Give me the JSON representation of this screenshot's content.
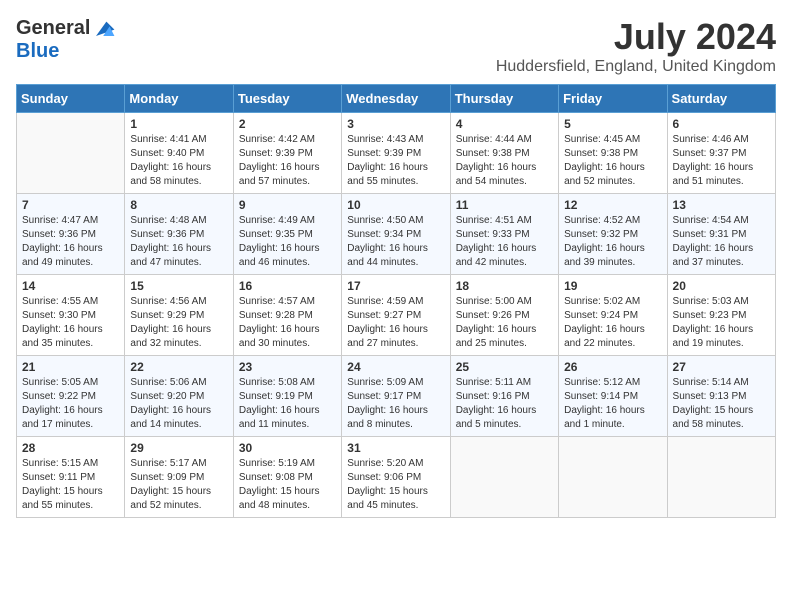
{
  "header": {
    "logo_general": "General",
    "logo_blue": "Blue",
    "month_year": "July 2024",
    "location": "Huddersfield, England, United Kingdom"
  },
  "days_of_week": [
    "Sunday",
    "Monday",
    "Tuesday",
    "Wednesday",
    "Thursday",
    "Friday",
    "Saturday"
  ],
  "weeks": [
    [
      {
        "day": "",
        "sunrise": "",
        "sunset": "",
        "daylight": ""
      },
      {
        "day": "1",
        "sunrise": "Sunrise: 4:41 AM",
        "sunset": "Sunset: 9:40 PM",
        "daylight": "Daylight: 16 hours and 58 minutes."
      },
      {
        "day": "2",
        "sunrise": "Sunrise: 4:42 AM",
        "sunset": "Sunset: 9:39 PM",
        "daylight": "Daylight: 16 hours and 57 minutes."
      },
      {
        "day": "3",
        "sunrise": "Sunrise: 4:43 AM",
        "sunset": "Sunset: 9:39 PM",
        "daylight": "Daylight: 16 hours and 55 minutes."
      },
      {
        "day": "4",
        "sunrise": "Sunrise: 4:44 AM",
        "sunset": "Sunset: 9:38 PM",
        "daylight": "Daylight: 16 hours and 54 minutes."
      },
      {
        "day": "5",
        "sunrise": "Sunrise: 4:45 AM",
        "sunset": "Sunset: 9:38 PM",
        "daylight": "Daylight: 16 hours and 52 minutes."
      },
      {
        "day": "6",
        "sunrise": "Sunrise: 4:46 AM",
        "sunset": "Sunset: 9:37 PM",
        "daylight": "Daylight: 16 hours and 51 minutes."
      }
    ],
    [
      {
        "day": "7",
        "sunrise": "Sunrise: 4:47 AM",
        "sunset": "Sunset: 9:36 PM",
        "daylight": "Daylight: 16 hours and 49 minutes."
      },
      {
        "day": "8",
        "sunrise": "Sunrise: 4:48 AM",
        "sunset": "Sunset: 9:36 PM",
        "daylight": "Daylight: 16 hours and 47 minutes."
      },
      {
        "day": "9",
        "sunrise": "Sunrise: 4:49 AM",
        "sunset": "Sunset: 9:35 PM",
        "daylight": "Daylight: 16 hours and 46 minutes."
      },
      {
        "day": "10",
        "sunrise": "Sunrise: 4:50 AM",
        "sunset": "Sunset: 9:34 PM",
        "daylight": "Daylight: 16 hours and 44 minutes."
      },
      {
        "day": "11",
        "sunrise": "Sunrise: 4:51 AM",
        "sunset": "Sunset: 9:33 PM",
        "daylight": "Daylight: 16 hours and 42 minutes."
      },
      {
        "day": "12",
        "sunrise": "Sunrise: 4:52 AM",
        "sunset": "Sunset: 9:32 PM",
        "daylight": "Daylight: 16 hours and 39 minutes."
      },
      {
        "day": "13",
        "sunrise": "Sunrise: 4:54 AM",
        "sunset": "Sunset: 9:31 PM",
        "daylight": "Daylight: 16 hours and 37 minutes."
      }
    ],
    [
      {
        "day": "14",
        "sunrise": "Sunrise: 4:55 AM",
        "sunset": "Sunset: 9:30 PM",
        "daylight": "Daylight: 16 hours and 35 minutes."
      },
      {
        "day": "15",
        "sunrise": "Sunrise: 4:56 AM",
        "sunset": "Sunset: 9:29 PM",
        "daylight": "Daylight: 16 hours and 32 minutes."
      },
      {
        "day": "16",
        "sunrise": "Sunrise: 4:57 AM",
        "sunset": "Sunset: 9:28 PM",
        "daylight": "Daylight: 16 hours and 30 minutes."
      },
      {
        "day": "17",
        "sunrise": "Sunrise: 4:59 AM",
        "sunset": "Sunset: 9:27 PM",
        "daylight": "Daylight: 16 hours and 27 minutes."
      },
      {
        "day": "18",
        "sunrise": "Sunrise: 5:00 AM",
        "sunset": "Sunset: 9:26 PM",
        "daylight": "Daylight: 16 hours and 25 minutes."
      },
      {
        "day": "19",
        "sunrise": "Sunrise: 5:02 AM",
        "sunset": "Sunset: 9:24 PM",
        "daylight": "Daylight: 16 hours and 22 minutes."
      },
      {
        "day": "20",
        "sunrise": "Sunrise: 5:03 AM",
        "sunset": "Sunset: 9:23 PM",
        "daylight": "Daylight: 16 hours and 19 minutes."
      }
    ],
    [
      {
        "day": "21",
        "sunrise": "Sunrise: 5:05 AM",
        "sunset": "Sunset: 9:22 PM",
        "daylight": "Daylight: 16 hours and 17 minutes."
      },
      {
        "day": "22",
        "sunrise": "Sunrise: 5:06 AM",
        "sunset": "Sunset: 9:20 PM",
        "daylight": "Daylight: 16 hours and 14 minutes."
      },
      {
        "day": "23",
        "sunrise": "Sunrise: 5:08 AM",
        "sunset": "Sunset: 9:19 PM",
        "daylight": "Daylight: 16 hours and 11 minutes."
      },
      {
        "day": "24",
        "sunrise": "Sunrise: 5:09 AM",
        "sunset": "Sunset: 9:17 PM",
        "daylight": "Daylight: 16 hours and 8 minutes."
      },
      {
        "day": "25",
        "sunrise": "Sunrise: 5:11 AM",
        "sunset": "Sunset: 9:16 PM",
        "daylight": "Daylight: 16 hours and 5 minutes."
      },
      {
        "day": "26",
        "sunrise": "Sunrise: 5:12 AM",
        "sunset": "Sunset: 9:14 PM",
        "daylight": "Daylight: 16 hours and 1 minute."
      },
      {
        "day": "27",
        "sunrise": "Sunrise: 5:14 AM",
        "sunset": "Sunset: 9:13 PM",
        "daylight": "Daylight: 15 hours and 58 minutes."
      }
    ],
    [
      {
        "day": "28",
        "sunrise": "Sunrise: 5:15 AM",
        "sunset": "Sunset: 9:11 PM",
        "daylight": "Daylight: 15 hours and 55 minutes."
      },
      {
        "day": "29",
        "sunrise": "Sunrise: 5:17 AM",
        "sunset": "Sunset: 9:09 PM",
        "daylight": "Daylight: 15 hours and 52 minutes."
      },
      {
        "day": "30",
        "sunrise": "Sunrise: 5:19 AM",
        "sunset": "Sunset: 9:08 PM",
        "daylight": "Daylight: 15 hours and 48 minutes."
      },
      {
        "day": "31",
        "sunrise": "Sunrise: 5:20 AM",
        "sunset": "Sunset: 9:06 PM",
        "daylight": "Daylight: 15 hours and 45 minutes."
      },
      {
        "day": "",
        "sunrise": "",
        "sunset": "",
        "daylight": ""
      },
      {
        "day": "",
        "sunrise": "",
        "sunset": "",
        "daylight": ""
      },
      {
        "day": "",
        "sunrise": "",
        "sunset": "",
        "daylight": ""
      }
    ]
  ]
}
